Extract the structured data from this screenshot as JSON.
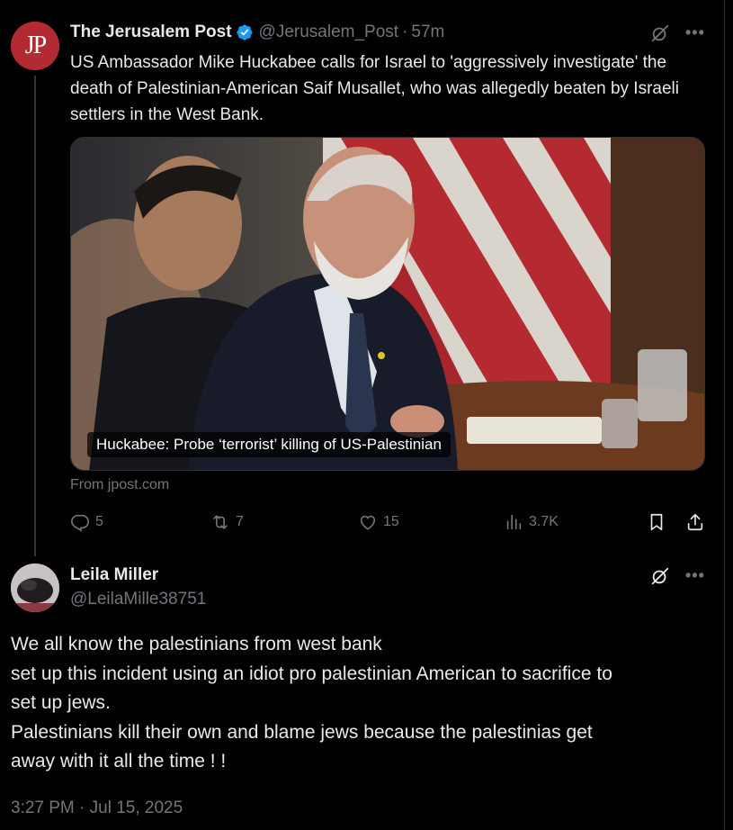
{
  "parent_tweet": {
    "avatar_text": "JP",
    "author_name": "The Jerusalem Post",
    "handle": "@Jerusalem_Post",
    "separator": "·",
    "time": "57m",
    "text": "US Ambassador Mike Huckabee calls for Israel to 'aggressively investigate' the death of Palestinian-American Saif Musallet, who was allegedly beaten by Israeli settlers in the West Bank.",
    "card_caption": "Huckabee: Probe ‘terrorist’ killing of US-Palestinian",
    "card_source": "From jpost.com",
    "stats": {
      "replies": "5",
      "reposts": "7",
      "likes": "15",
      "views": "3.7K"
    }
  },
  "reply_tweet": {
    "author_name": "Leila Miller",
    "handle": "@LeilaMille38751",
    "text_lines": [
      "We all know the palestinians from west bank",
      "set up this incident using an idiot pro palestinian American to sacrifice to",
      "set up jews.",
      "Palestinians kill their own and blame jews because the palestinias get",
      "away with it all the time ! !"
    ],
    "timestamp": "3:27 PM · Jul 15, 2025"
  },
  "icons": {
    "verified": "verified-badge-icon",
    "grok": "grok-icon",
    "more": "more-icon",
    "reply": "reply-icon",
    "repost": "repost-icon",
    "like": "like-icon",
    "views": "views-icon",
    "bookmark": "bookmark-icon",
    "share": "share-icon"
  },
  "colors": {
    "background": "#000000",
    "text_primary": "#e7e9ea",
    "text_secondary": "#71767b",
    "verified_blue": "#1d9bf0",
    "jp_red": "#b32b32"
  }
}
